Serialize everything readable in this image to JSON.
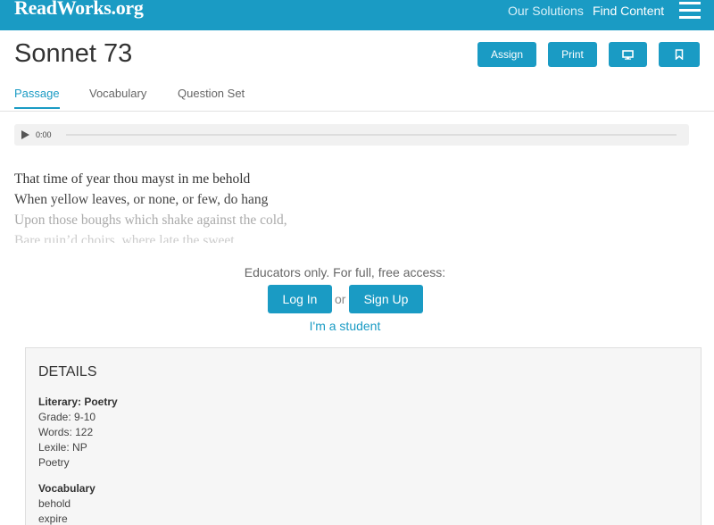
{
  "nav": {
    "logo": "ReadWorks.org",
    "links": [
      "Our Solutions",
      "Find Content"
    ]
  },
  "page": {
    "title": "Sonnet 73",
    "buttons": {
      "assign": "Assign",
      "print": "Print"
    }
  },
  "tabs": [
    "Passage",
    "Vocabulary",
    "Question Set"
  ],
  "audio": {
    "time": "0:00"
  },
  "poem": [
    "That time of year thou mayst in me behold",
    "When yellow leaves, or none, or few, do hang",
    "Upon those boughs which shake against the cold,",
    "Bare ruin’d choirs, where late the sweet..."
  ],
  "access": {
    "prompt": "Educators only. For full, free access:",
    "login": "Log In",
    "or": "or",
    "signup": "Sign Up",
    "student": "I'm a student"
  },
  "details": {
    "heading": "DETAILS",
    "category": "Literary: Poetry",
    "grade": "Grade: 9-10",
    "words": "Words: 122",
    "lexile": "Lexile: NP",
    "genre": "Poetry",
    "vocab_heading": "Vocabulary",
    "vocab": [
      "behold",
      "expire"
    ]
  },
  "colors": {
    "accent": "#1a9bc4"
  }
}
